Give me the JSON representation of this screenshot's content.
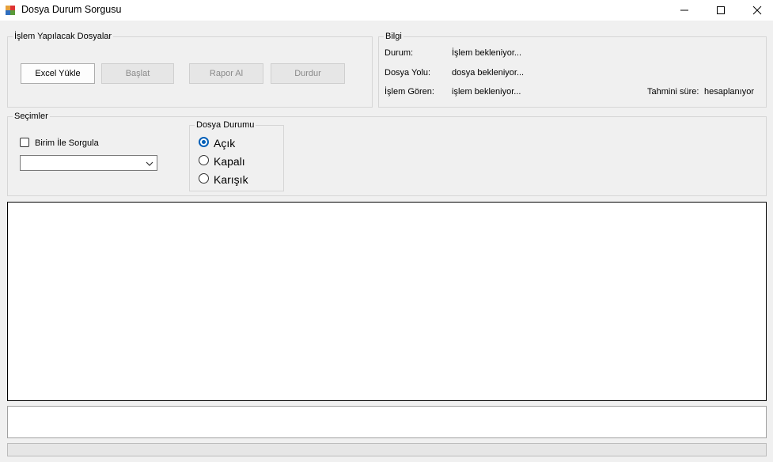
{
  "window": {
    "title": "Dosya Durum Sorgusu",
    "minimize_icon": "minimize-icon",
    "maximize_icon": "maximize-icon",
    "close_icon": "close-icon"
  },
  "files_group": {
    "legend": "İşlem Yapılacak Dosyalar",
    "buttons": {
      "excel": "Excel Yükle",
      "start": "Başlat",
      "report": "Rapor Al",
      "stop": "Durdur"
    }
  },
  "info_group": {
    "legend": "Bilgi",
    "status_label": "Durum:",
    "status_value": "İşlem bekleniyor...",
    "path_label": "Dosya Yolu:",
    "path_value": "dosya bekleniyor...",
    "processed_label": "İşlem Gören:",
    "processed_value": "işlem bekleniyor...",
    "eta_label": "Tahmini süre:",
    "eta_value": "hesaplanıyor"
  },
  "options_group": {
    "legend": "Seçimler",
    "unit_query_label": "Birim İle Sorgula",
    "unit_query_checked": false,
    "unit_select_value": "",
    "file_status": {
      "legend": "Dosya Durumu",
      "options": [
        "Açık",
        "Kapalı",
        "Karışık"
      ],
      "selected": "Açık"
    }
  },
  "progress": {
    "value": 0
  },
  "colors": {
    "accent": "#005fb8",
    "window_bg": "#f0f0f0"
  }
}
